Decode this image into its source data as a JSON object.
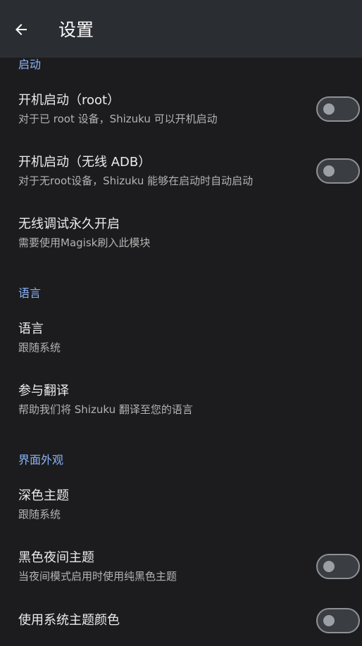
{
  "appbar": {
    "title": "设置",
    "back_icon": "arrow-back-icon"
  },
  "colors": {
    "accent": "#8ab4f8",
    "background": "#1c1c1e",
    "appbar": "#2a2d31"
  },
  "sections": {
    "startup": {
      "header": "启动",
      "items": [
        {
          "title": "开机启动（root）",
          "summary": "对于已 root 设备，Shizuku 可以开机启动",
          "switch_on": false
        },
        {
          "title": "开机启动（无线 ADB）",
          "summary": "对于无root设备，Shizuku 能够在启动时自动启动",
          "switch_on": false
        },
        {
          "title": "无线调试永久开启",
          "summary": "需要使用Magisk刷入此模块"
        }
      ]
    },
    "language": {
      "header": "语言",
      "items": [
        {
          "title": "语言",
          "summary": "跟随系统"
        },
        {
          "title": "参与翻译",
          "summary": "帮助我们将 Shizuku 翻译至您的语言"
        }
      ]
    },
    "appearance": {
      "header": "界面外观",
      "items": [
        {
          "title": "深色主题",
          "summary": "跟随系统"
        },
        {
          "title": "黑色夜间主题",
          "summary": "当夜间模式启用时使用纯黑色主题",
          "switch_on": false
        },
        {
          "title": "使用系统主题颜色",
          "switch_on": false
        }
      ]
    }
  }
}
